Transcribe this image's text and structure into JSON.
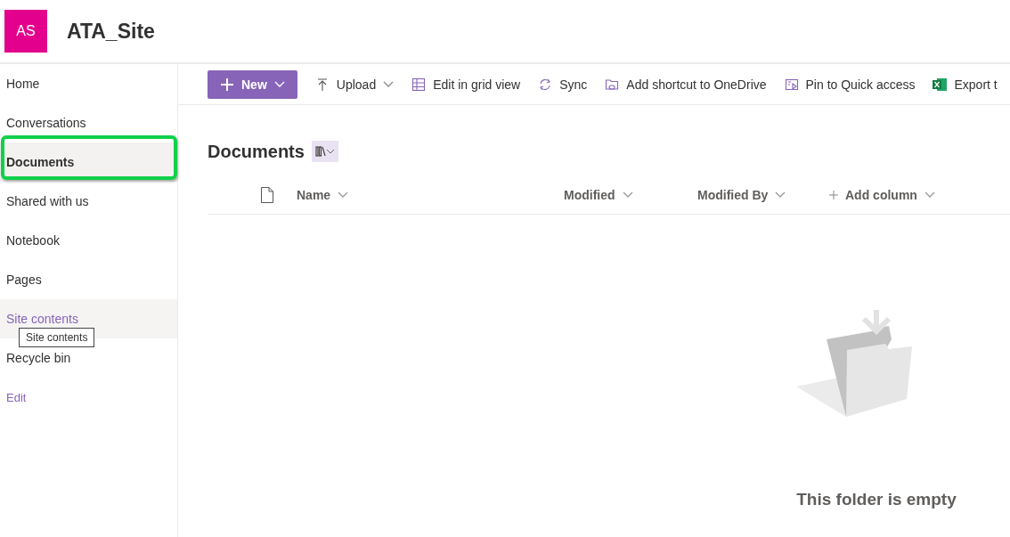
{
  "site": {
    "logo": "AS",
    "title": "ATA_Site"
  },
  "nav": [
    {
      "label": "Home",
      "kind": "link",
      "selected": false,
      "hovered": false,
      "highlighted": false
    },
    {
      "label": "Conversations",
      "kind": "link",
      "selected": false,
      "hovered": false,
      "highlighted": false
    },
    {
      "label": "Documents",
      "kind": "link",
      "selected": true,
      "hovered": false,
      "highlighted": true
    },
    {
      "label": "Shared with us",
      "kind": "link",
      "selected": false,
      "hovered": false,
      "highlighted": false
    },
    {
      "label": "Notebook",
      "kind": "link",
      "selected": false,
      "hovered": false,
      "highlighted": false
    },
    {
      "label": "Pages",
      "kind": "link",
      "selected": false,
      "hovered": false,
      "highlighted": false
    },
    {
      "label": "Site contents",
      "kind": "link",
      "selected": false,
      "hovered": true,
      "highlighted": false,
      "tooltip": "Site contents"
    },
    {
      "label": "Recycle bin",
      "kind": "link",
      "selected": false,
      "hovered": false,
      "highlighted": false
    },
    {
      "label": "Edit",
      "kind": "edit",
      "selected": false,
      "hovered": false,
      "highlighted": false
    }
  ],
  "toolbar": [
    {
      "label": "New",
      "kind": "primary",
      "dropdown": true
    },
    {
      "label": "Upload",
      "kind": "command",
      "dropdown": true
    },
    {
      "label": "Edit in grid view",
      "kind": "command",
      "dropdown": false
    },
    {
      "label": "Sync",
      "kind": "command",
      "dropdown": false
    },
    {
      "label": "Add shortcut to OneDrive",
      "kind": "command",
      "dropdown": false
    },
    {
      "label": "Pin to Quick access",
      "kind": "command",
      "dropdown": false
    },
    {
      "label": "Export t",
      "kind": "command",
      "dropdown": false
    }
  ],
  "library": {
    "title": "Documents"
  },
  "table": {
    "columns": [
      {
        "label": "Name",
        "kind": "sort"
      },
      {
        "label": "Modified",
        "kind": "sort"
      },
      {
        "label": "Modified By",
        "kind": "sort"
      },
      {
        "label": "Add column",
        "kind": "add"
      }
    ]
  },
  "empty_state": {
    "message": "This folder is empty"
  }
}
